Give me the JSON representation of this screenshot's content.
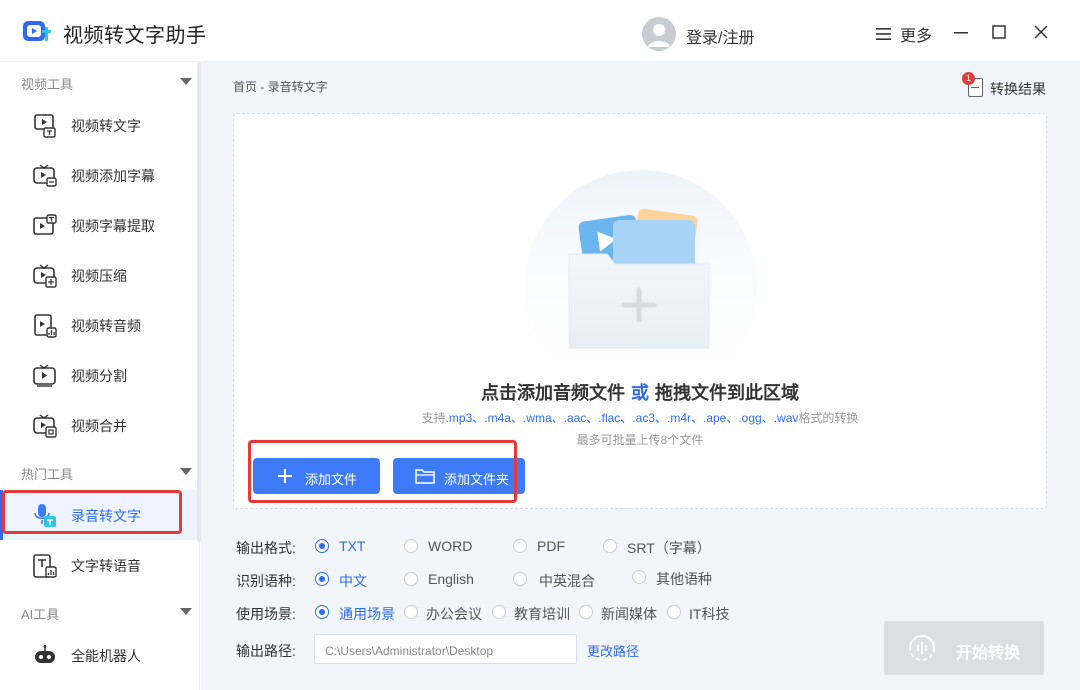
{
  "app": {
    "title": "视频转文字助手",
    "login_label": "登录/注册",
    "more_label": "更多"
  },
  "sidebar": {
    "sections": [
      {
        "title": "视频工具",
        "items": [
          "视频转文字",
          "视频添加字幕",
          "视频字幕提取",
          "视频压缩",
          "视频转音频",
          "视频分割",
          "视频合并"
        ]
      },
      {
        "title": "热门工具",
        "items": [
          "录音转文字",
          "文字转语音"
        ]
      },
      {
        "title": "AI工具",
        "items": [
          "全能机器人"
        ]
      }
    ],
    "active_item": "录音转文字"
  },
  "breadcrumb": "首页 - 录音转文字",
  "results": {
    "label": "转换结果",
    "badge": "1"
  },
  "dropzone": {
    "title_part1": "点击添加音频文件",
    "title_or": "或",
    "title_part2": "拖拽文件到此区域",
    "formats_prefix": "支持",
    "formats": ".mp3、.m4a、.wma、.aac、.flac、.ac3、.m4r、.ape、.ogg、.wav",
    "formats_suffix": "格式的转换",
    "limit": "最多可批量上传8个文件",
    "add_file_label": "添加文件",
    "add_folder_label": "添加文件夹"
  },
  "options": {
    "output_format": {
      "label": "输出格式:",
      "choices": [
        "TXT",
        "WORD",
        "PDF",
        "SRT（字幕）"
      ],
      "selected": "TXT"
    },
    "language": {
      "label": "识别语种:",
      "choices": [
        "中文",
        "English",
        "中英混合",
        "其他语种"
      ],
      "selected": "中文"
    },
    "scene": {
      "label": "使用场景:",
      "choices": [
        "通用场景",
        "办公会议",
        "教育培训",
        "新闻媒体",
        "IT科技"
      ],
      "selected": "通用场景"
    },
    "output_path": {
      "label": "输出路径:",
      "value": "C:\\Users\\Administrator\\Desktop",
      "change_label": "更改路径"
    }
  },
  "start_label": "开始转换",
  "colors": {
    "accent": "#2f6bf2",
    "button_blue": "#3d7cf6",
    "highlight_red": "#e43a35",
    "disabled_gray": "#dcdee2"
  }
}
